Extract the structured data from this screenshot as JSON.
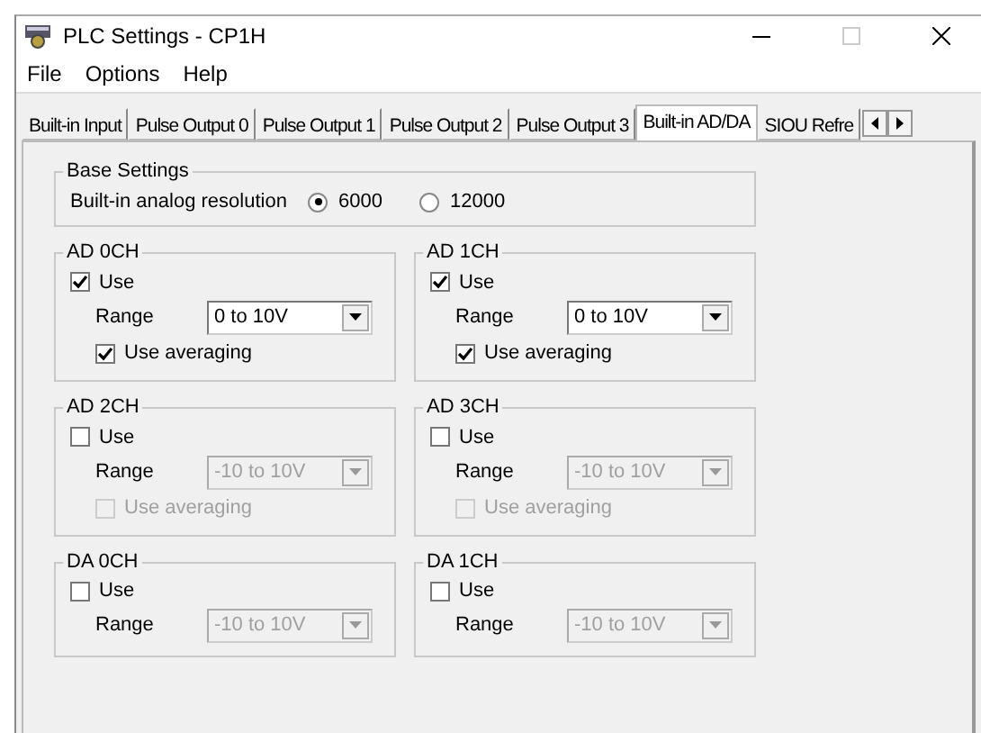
{
  "window": {
    "title": "PLC Settings - CP1H"
  },
  "menu": [
    "File",
    "Options",
    "Help"
  ],
  "tabs": [
    {
      "label": "Built-in Input",
      "selected": false
    },
    {
      "label": "Pulse Output 0",
      "selected": false
    },
    {
      "label": "Pulse Output 1",
      "selected": false
    },
    {
      "label": "Pulse Output 2",
      "selected": false
    },
    {
      "label": "Pulse Output 3",
      "selected": false
    },
    {
      "label": "Built-in AD/DA",
      "selected": true
    },
    {
      "label": "SIOU Refre",
      "selected": false
    }
  ],
  "base_settings": {
    "title": "Base Settings",
    "label": "Built-in analog resolution",
    "options": [
      {
        "label": "6000",
        "selected": true
      },
      {
        "label": "12000",
        "selected": false
      }
    ]
  },
  "channels": [
    {
      "title": "AD 0CH",
      "use": {
        "label": "Use",
        "checked": true
      },
      "range": {
        "label": "Range",
        "value": "0 to 10V"
      },
      "averaging": {
        "label": "Use averaging",
        "checked": true
      }
    },
    {
      "title": "AD 1CH",
      "use": {
        "label": "Use",
        "checked": true
      },
      "range": {
        "label": "Range",
        "value": "0 to 10V"
      },
      "averaging": {
        "label": "Use averaging",
        "checked": true
      }
    },
    {
      "title": "AD 2CH",
      "use": {
        "label": "Use",
        "checked": false
      },
      "range": {
        "label": "Range",
        "value": "-10 to 10V"
      },
      "averaging": {
        "label": "Use averaging",
        "checked": false
      }
    },
    {
      "title": "AD 3CH",
      "use": {
        "label": "Use",
        "checked": false
      },
      "range": {
        "label": "Range",
        "value": "-10 to 10V"
      },
      "averaging": {
        "label": "Use averaging",
        "checked": false
      }
    },
    {
      "title": "DA 0CH",
      "use": {
        "label": "Use",
        "checked": false
      },
      "range": {
        "label": "Range",
        "value": "-10 to 10V"
      }
    },
    {
      "title": "DA 1CH",
      "use": {
        "label": "Use",
        "checked": false
      },
      "range": {
        "label": "Range",
        "value": "-10 to 10V"
      }
    }
  ]
}
